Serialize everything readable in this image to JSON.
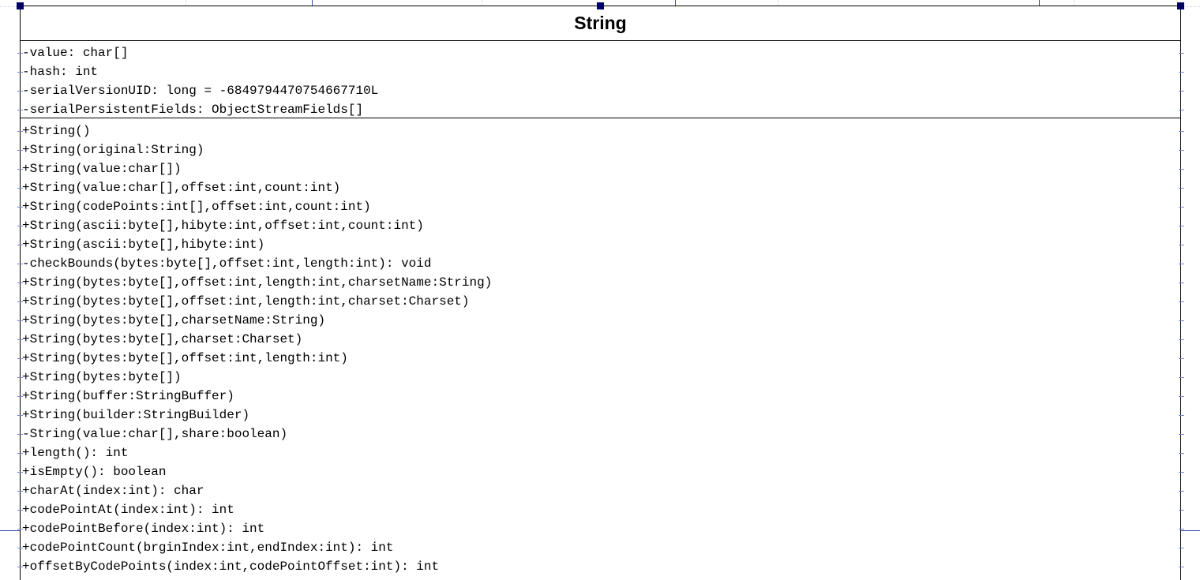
{
  "diagram": {
    "class_name": "String",
    "attributes": [
      "-value: char[]",
      "-hash: int",
      "-serialVersionUID: long = -6849794470754667710L",
      "-serialPersistentFields: ObjectStreamFields[]"
    ],
    "operations": [
      "+String()",
      "+String(original:String)",
      "+String(value:char[])",
      "+String(value:char[],offset:int,count:int)",
      "+String(codePoints:int[],offset:int,count:int)",
      "+String(ascii:byte[],hibyte:int,offset:int,count:int)",
      "+String(ascii:byte[],hibyte:int)",
      "-checkBounds(bytes:byte[],offset:int,length:int): void",
      "+String(bytes:byte[],offset:int,length:int,charsetName:String)",
      "+String(bytes:byte[],offset:int,length:int,charset:Charset)",
      "+String(bytes:byte[],charsetName:String)",
      "+String(bytes:byte[],charset:Charset)",
      "+String(bytes:byte[],offset:int,length:int)",
      "+String(bytes:byte[])",
      "+String(buffer:StringBuffer)",
      "+String(builder:StringBuilder)",
      "-String(value:char[],share:boolean)",
      "+length(): int",
      "+isEmpty(): boolean",
      "+charAt(index:int): char",
      "+codePointAt(index:int): int",
      "+codePointBefore(index:int): int",
      "+codePointCount(brginIndex:int,endIndex:int): int",
      "+offsetByCodePoints(index:int,codePointOffset:int): int"
    ]
  },
  "colors": {
    "handle": "#000066",
    "grid": "#d0d8e8",
    "connector": "#3a4ab0"
  }
}
